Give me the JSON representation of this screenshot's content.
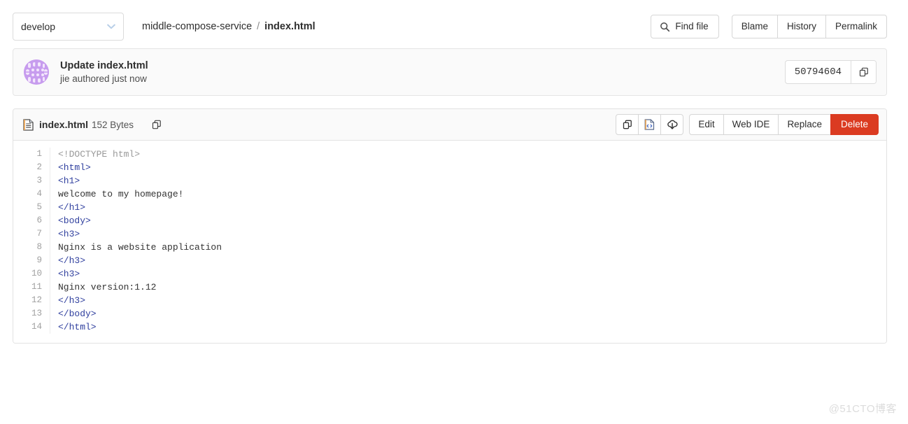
{
  "topbar": {
    "branch": {
      "value": "develop",
      "icon": "chevron-down-icon"
    },
    "breadcrumb": {
      "repo": "middle-compose-service",
      "separator": "/",
      "current": "index.html"
    },
    "find_file_label": "Find file",
    "find_file_icon": "search-icon",
    "actions": [
      "Blame",
      "History",
      "Permalink"
    ]
  },
  "commit": {
    "title": "Update index.html",
    "author": "jie",
    "meta": "jie authored just now",
    "sha": "50794604",
    "copy_icon": "copy-icon",
    "avatar": "identicon-avatar"
  },
  "file": {
    "icon": "document-icon",
    "name": "index.html",
    "size": "152 Bytes",
    "copy_path_icon": "copy-icon",
    "icon_buttons": [
      {
        "name": "copy-contents-icon",
        "title": "Copy file contents"
      },
      {
        "name": "open-raw-icon",
        "title": "Open raw"
      },
      {
        "name": "download-icon",
        "title": "Download"
      }
    ],
    "buttons": [
      {
        "label": "Edit",
        "style": "default"
      },
      {
        "label": "Web IDE",
        "style": "default"
      },
      {
        "label": "Replace",
        "style": "default"
      },
      {
        "label": "Delete",
        "style": "danger"
      }
    ]
  },
  "code": {
    "lines": [
      {
        "n": 1,
        "tokens": [
          {
            "t": "<!DOCTYPE html>",
            "c": "tok-doctype"
          }
        ]
      },
      {
        "n": 2,
        "tokens": [
          {
            "t": "<html>",
            "c": "tok-tag"
          }
        ]
      },
      {
        "n": 3,
        "tokens": [
          {
            "t": "<h1>",
            "c": "tok-tag"
          }
        ]
      },
      {
        "n": 4,
        "tokens": [
          {
            "t": "welcome to my homepage!",
            "c": "tok-text"
          }
        ]
      },
      {
        "n": 5,
        "tokens": [
          {
            "t": "</h1>",
            "c": "tok-tag"
          }
        ]
      },
      {
        "n": 6,
        "tokens": [
          {
            "t": "<body>",
            "c": "tok-tag"
          }
        ]
      },
      {
        "n": 7,
        "tokens": [
          {
            "t": "<h3>",
            "c": "tok-tag"
          }
        ]
      },
      {
        "n": 8,
        "tokens": [
          {
            "t": "Nginx is a website application",
            "c": "tok-text"
          }
        ]
      },
      {
        "n": 9,
        "tokens": [
          {
            "t": "</h3>",
            "c": "tok-tag"
          }
        ]
      },
      {
        "n": 10,
        "tokens": [
          {
            "t": "<h3>",
            "c": "tok-tag"
          }
        ]
      },
      {
        "n": 11,
        "tokens": [
          {
            "t": "Nginx version:1.12",
            "c": "tok-text"
          }
        ]
      },
      {
        "n": 12,
        "tokens": [
          {
            "t": "</h3>",
            "c": "tok-tag"
          }
        ]
      },
      {
        "n": 13,
        "tokens": [
          {
            "t": "</body>",
            "c": "tok-tag"
          }
        ]
      },
      {
        "n": 14,
        "tokens": [
          {
            "t": "</html>",
            "c": "tok-tag"
          }
        ]
      }
    ]
  },
  "watermark": {
    "text": "@51CTO博客"
  },
  "colors": {
    "danger": "#db3b21",
    "tag": "#2f3f9e",
    "doctype": "#999999",
    "panel_bg": "#fafafa",
    "border": "#e2e2e2",
    "avatar_purple": "#b07be0"
  }
}
